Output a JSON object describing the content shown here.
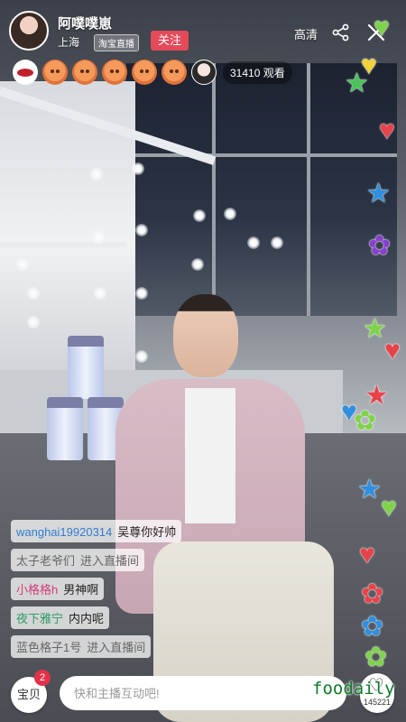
{
  "host": {
    "name": "阿噗噗崽",
    "city": "上海",
    "badge": "淘宝直播",
    "follow_label": "关注"
  },
  "top_actions": {
    "quality_label": "高清",
    "share_icon": "share-icon",
    "close_icon": "close-icon"
  },
  "viewers": {
    "avatars": [
      "lips-avatar",
      "orange-face-avatar",
      "orange-face-avatar",
      "orange-face-avatar",
      "orange-face-avatar",
      "orange-face-avatar",
      "photo-avatar"
    ],
    "count_text": "31410 观看"
  },
  "chat": {
    "messages": [
      {
        "user": "wanghai19920314",
        "text": "吴尊你好帅"
      },
      {
        "user": "太子老爷们",
        "text": "进入直播间"
      },
      {
        "user": "小格格h",
        "text": "男神啊"
      },
      {
        "user": "夜下雅宁",
        "text": "内内呢"
      },
      {
        "user": "蓝色格子1号",
        "text": "进入直播间"
      }
    ]
  },
  "bottom": {
    "bag_label": "宝贝",
    "bag_count": "2",
    "input_placeholder": "快和主播互动吧!",
    "like_count": "145221",
    "watermark": "foodaily"
  },
  "colors": {
    "follow": "#e34a5a",
    "badge_red": "#e3324a",
    "watermark": "#0d7a2c"
  }
}
